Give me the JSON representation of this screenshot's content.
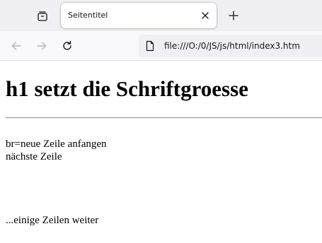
{
  "tab": {
    "title": "Seitentitel"
  },
  "navigation": {
    "url": "file:///O:/0/JS/js/html/index3.htm"
  },
  "page": {
    "heading": "h1 setzt die Schriftgroesse",
    "line1": "br=neue Zeile anfangen",
    "line2": "nächste Zeile",
    "line3": "...einige Zeilen weiter"
  },
  "icons": {
    "tab_overview": "tab-overview-icon",
    "tab_close": "close-icon",
    "new_tab": "plus-icon",
    "back": "arrow-left-icon",
    "forward": "arrow-right-icon",
    "reload": "reload-icon",
    "page": "page-icon"
  },
  "colors": {
    "tabstrip_bg": "#f0f0f4",
    "toolbar_bg": "#f9f9fb",
    "urlbar_bg": "#f0f0f4",
    "disabled_icon": "#b4b4bb",
    "icon": "#15141a"
  }
}
